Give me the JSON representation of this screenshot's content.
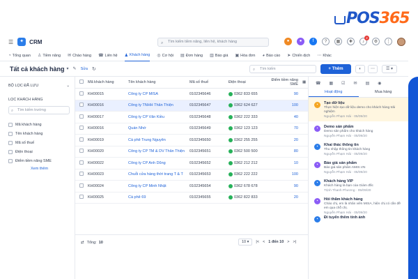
{
  "brand": {
    "text_a": "POS",
    "text_b": "365"
  },
  "app": {
    "name": "CRM",
    "icon": "crm-app-icon"
  },
  "top_search": {
    "placeholder": "Tìm kiếm tiềm năng, liên hệ, khách hàng"
  },
  "top_icons": [
    {
      "name": "orange-status-icon",
      "color": "#f08a24"
    },
    {
      "name": "purple-status-icon",
      "color": "#8b5cf6"
    },
    {
      "name": "facebook-icon",
      "color": "#1877f2"
    },
    {
      "name": "help-icon",
      "color": "#444444"
    },
    {
      "name": "calendar-icon",
      "color": "#444444"
    },
    {
      "name": "puzzle-icon",
      "color": "#444444"
    },
    {
      "name": "bell-icon",
      "color": "#444444",
      "badge": "2"
    },
    {
      "name": "settings-icon",
      "color": "#444444"
    },
    {
      "name": "apps-icon",
      "color": "#444444"
    }
  ],
  "menu": [
    {
      "label": "Tổng quan",
      "icon": "dashboard-icon"
    },
    {
      "label": "Tiềm năng",
      "icon": "prospect-icon"
    },
    {
      "label": "Chào hàng",
      "icon": "offer-icon"
    },
    {
      "label": "Liên hệ",
      "icon": "contact-icon"
    },
    {
      "label": "Khách hàng",
      "icon": "customer-icon",
      "active": true
    },
    {
      "label": "Cơ hội",
      "icon": "opportunity-icon"
    },
    {
      "label": "Đơn hàng",
      "icon": "order-icon"
    },
    {
      "label": "Báo giá",
      "icon": "quote-icon"
    },
    {
      "label": "Hóa đơn",
      "icon": "invoice-icon"
    },
    {
      "label": "Báo cáo",
      "icon": "report-icon"
    },
    {
      "label": "Chiến dịch",
      "icon": "campaign-icon"
    },
    {
      "label": "Khác",
      "icon": "more-icon"
    }
  ],
  "toolbar": {
    "view_title": "Tất cả khách hàng",
    "edit_label": "Sửa",
    "search_placeholder": "Tìm kiếm",
    "add_label": "+ Thêm"
  },
  "filter": {
    "saved_header": "BỘ LỌC ĐÃ LƯU",
    "section_header": "LỌC KHÁCH HÀNG",
    "search_placeholder": "Tìm kiếm trường",
    "items": [
      "Mã khách hàng",
      "Tên khách hàng",
      "Mã số thuế",
      "Điện thoại",
      "Điểm tiềm năng SME"
    ],
    "more_label": "Xem thêm"
  },
  "table": {
    "headers": {
      "code": "Mã khách hàng",
      "name": "Tên khách hàng",
      "tax": "Mã số thuế",
      "phone": "Điện thoại",
      "score": "Điểm tiềm năng SME"
    },
    "rows": [
      {
        "code": "KH00015",
        "name": "Công ty CP MISA",
        "tax": "0102345646",
        "phone": "0362 833 655",
        "score": "90"
      },
      {
        "code": "KH00016",
        "name": "Công ty TNHH Thân Thiện",
        "tax": "0102345647",
        "phone": "0362 624 627",
        "score": "100",
        "selected": true
      },
      {
        "code": "KH00017",
        "name": "Công ty CP Văn Kiều",
        "tax": "0102345648",
        "phone": "0362 222 333",
        "score": "40"
      },
      {
        "code": "KH00016",
        "name": "Quán Nhớ",
        "tax": "0102345649",
        "phone": "0362 123 123",
        "score": "70"
      },
      {
        "code": "KH00019",
        "name": "Cà phê Trung Nguyên",
        "tax": "0102345650",
        "phone": "0362 255 255",
        "score": "20"
      },
      {
        "code": "KH00020",
        "name": "Công ty CP TM & DV Thân Thiện",
        "tax": "0102345651",
        "phone": "0362 500 500",
        "score": "80"
      },
      {
        "code": "KH00022",
        "name": "Công ty CP Anh Dũng",
        "tax": "0102345652",
        "phone": "0362 212 212",
        "score": "10"
      },
      {
        "code": "KH00023",
        "name": "Chuỗi cửa hàng thời trang T & T",
        "tax": "0102345653",
        "phone": "0362 222 222",
        "score": "100"
      },
      {
        "code": "KH00024",
        "name": "Công ty CP Minh Nhật",
        "tax": "0102345654",
        "phone": "0362 678 678",
        "score": "90"
      },
      {
        "code": "KH00025",
        "name": "Cà phê 69",
        "tax": "0102345655",
        "phone": "0362 822 833",
        "score": "20"
      }
    ],
    "footer": {
      "total_label": "Tổng:",
      "total": "10",
      "page_size": "10",
      "range": "1 đến 10"
    }
  },
  "right_panel": {
    "tabs": [
      "Hoạt động",
      "Mua hàng"
    ],
    "activities": [
      {
        "title": "Tạo dữ liệu",
        "desc": "Thực hiện tạo dữ liệu demo cho khách hàng trải nghiệm",
        "meta": "Nguyễn Phạm Hải · 05/09/20",
        "color": "#f5a623",
        "highlight": true
      },
      {
        "title": "Demo sản phẩm",
        "desc": "Demo sản phẩm cho khách hàng",
        "meta": "Nguyễn Phạm Hải · 05/09/20",
        "color": "#8b5cf6"
      },
      {
        "title": "Khai thác thông tin",
        "desc": "Thu nhập thông tin khách hàng",
        "meta": "Nguyễn Phạm Hải · 05/09/20",
        "color": "#2b7de9"
      },
      {
        "title": "Báo giá sản phẩm",
        "desc": "Báo giá sản phẩm AMIS.VN",
        "meta": "Nguyễn Phạm Hải · 05/09/20",
        "color": "#8b5cf6"
      },
      {
        "title": "Khách hàng VIP",
        "desc": "Khách hàng là bạn của Giám đốc",
        "meta": "Trịnh Thanh Phương · 05/09/20",
        "color": "#2b7de9"
      },
      {
        "title": "Hỏi thăm khách hàng",
        "desc": "Chào chị, em là nhân viên MISA, hiện chị có cần đề em qua chỗ chị.",
        "meta": "Nguyễn Phạm Hải · 05/09/20",
        "color": "#8b5cf6"
      },
      {
        "title": "Đi tuyển thêm tính ảnh",
        "desc": "",
        "meta": "",
        "color": "#2b7de9"
      }
    ]
  }
}
